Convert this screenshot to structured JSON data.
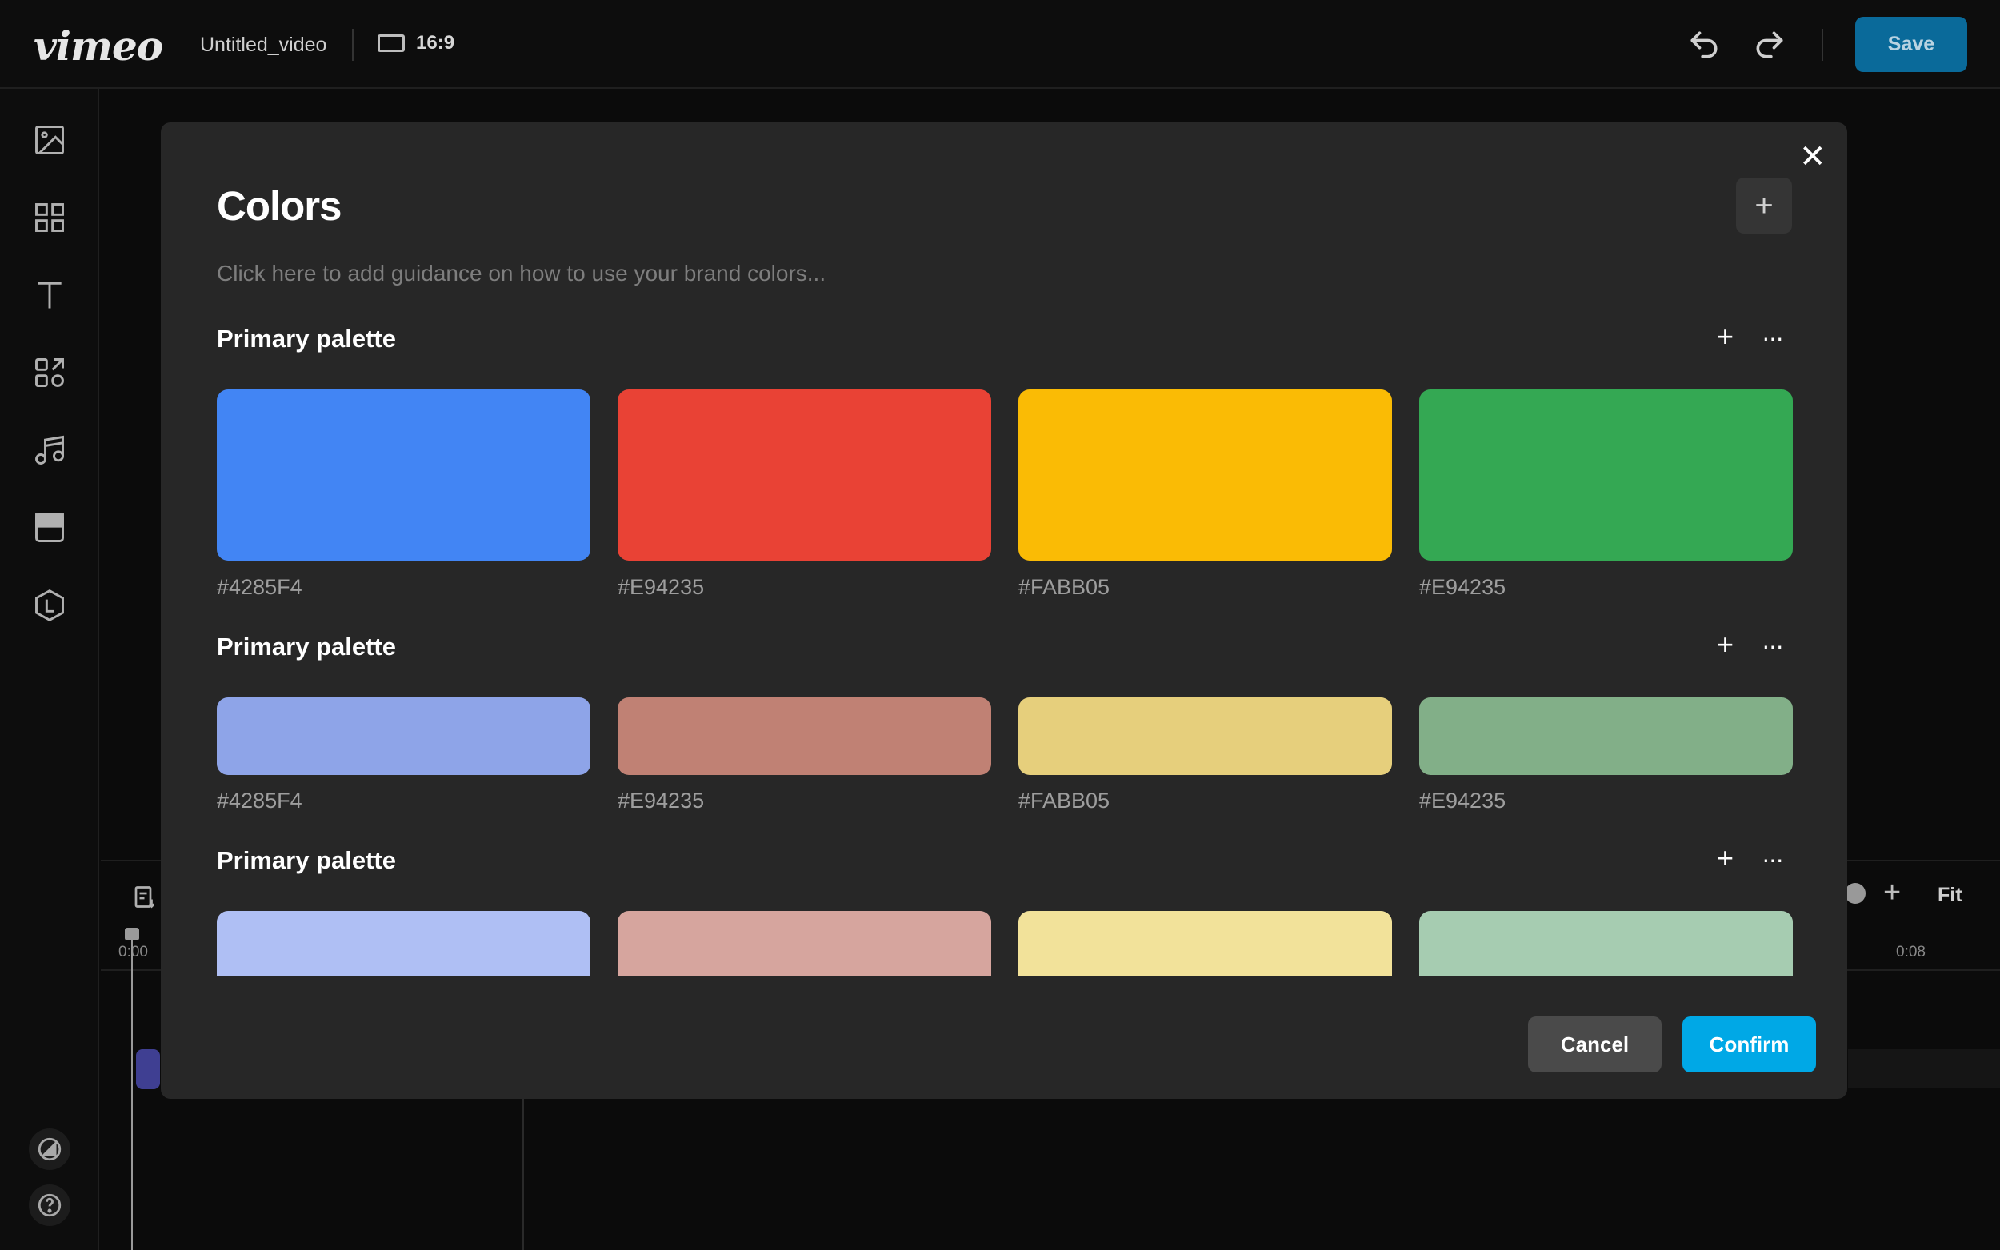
{
  "app": {
    "logo": "vimeo",
    "filename": "Untitled_video",
    "aspect_ratio": "16:9",
    "save_label": "Save"
  },
  "timeline": {
    "start_time": "0:00",
    "end_time": "0:08",
    "fit_label": "Fit",
    "zoom_plus": "+"
  },
  "modal": {
    "title": "Colors",
    "add_button": "+",
    "close_button": "✕",
    "guidance_placeholder": "Click here to add guidance on how to use your brand colors...",
    "cancel_label": "Cancel",
    "confirm_label": "Confirm",
    "palettes": [
      {
        "name": "Primary palette",
        "add": "+",
        "more": "···",
        "swatches": [
          {
            "hex": "#4285F4",
            "color": "#4285F4"
          },
          {
            "hex": "#E94235",
            "color": "#E94235"
          },
          {
            "hex": "#FABB05",
            "color": "#FABB05"
          },
          {
            "hex": "#E94235",
            "color": "#34A853"
          }
        ]
      },
      {
        "name": "Primary palette",
        "add": "+",
        "more": "···",
        "swatches": [
          {
            "hex": "#4285F4",
            "color": "#8EA4E8"
          },
          {
            "hex": "#E94235",
            "color": "#C08174"
          },
          {
            "hex": "#FABB05",
            "color": "#E6CF7C"
          },
          {
            "hex": "#E94235",
            "color": "#82AF88"
          }
        ]
      },
      {
        "name": "Primary palette",
        "add": "+",
        "more": "···",
        "swatches": [
          {
            "color": "#AFBFF4"
          },
          {
            "color": "#D6A59E"
          },
          {
            "color": "#F2E29A"
          },
          {
            "color": "#A6CCB1"
          }
        ]
      }
    ]
  }
}
